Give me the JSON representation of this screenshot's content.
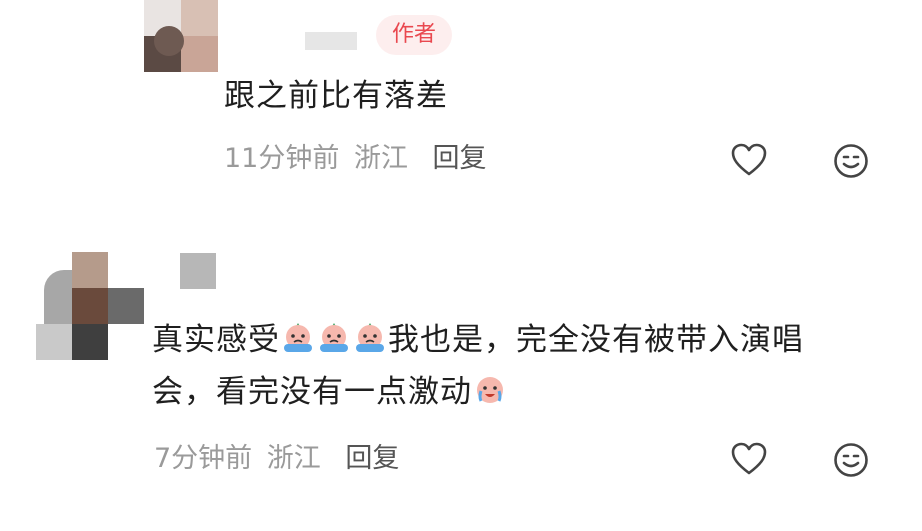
{
  "comments": [
    {
      "badge": "作者",
      "text": "跟之前比有落差",
      "time": "11分钟前",
      "location": "浙江",
      "reply_label": "回复",
      "icons": {
        "like": "heart-outline-icon",
        "react": "smile-face-icon"
      }
    },
    {
      "text_part1": "真实感受",
      "text_part2": "我也是，完全没有被带入演唱",
      "text_line2": "会，看完没有一点激动",
      "emoji_name": "crying-peach-emoji",
      "time": "7分钟前",
      "location": "浙江",
      "reply_label": "回复",
      "icons": {
        "like": "heart-outline-icon",
        "react": "smile-face-icon"
      }
    }
  ],
  "colors": {
    "badge_bg": "#fdeeee",
    "badge_text": "#e9484f",
    "meta": "#9a9a9a",
    "text": "#1f1f1f"
  }
}
